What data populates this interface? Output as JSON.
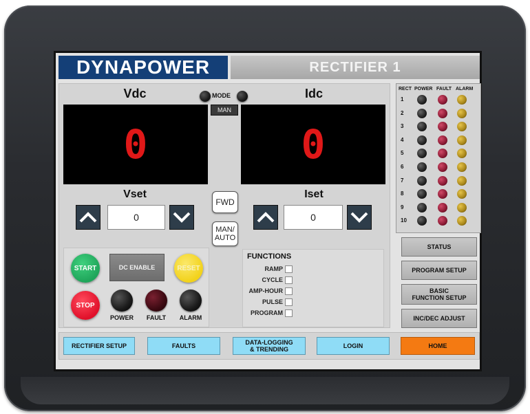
{
  "header": {
    "brand": "DYNAPOWER",
    "title": "RECTIFIER   1"
  },
  "voltage": {
    "label": "Vdc",
    "display_value": "0",
    "set_label": "Vset",
    "set_value": "0"
  },
  "current": {
    "label": "Idc",
    "display_value": "0",
    "set_label": "Iset",
    "set_value": "0"
  },
  "mode": {
    "label": "MODE",
    "value": "MAN"
  },
  "buttons": {
    "fwd": "FWD",
    "man_auto_line1": "MAN/",
    "man_auto_line2": "AUTO",
    "start": "START",
    "dc_enable": "DC ENABLE",
    "reset": "RESET",
    "stop": "STOP"
  },
  "indicators": {
    "power": "POWER",
    "fault": "FAULT",
    "alarm": "ALARM"
  },
  "functions": {
    "title": "FUNCTIONS",
    "items": [
      "RAMP",
      "CYCLE",
      "AMP-HOUR",
      "PULSE",
      "PROGRAM"
    ]
  },
  "status_table": {
    "headers": [
      "RECT",
      "POWER",
      "FAULT",
      "ALARM"
    ],
    "rows": [
      "1",
      "2",
      "3",
      "4",
      "5",
      "6",
      "7",
      "8",
      "9",
      "10"
    ]
  },
  "side_menu": {
    "status": "STATUS",
    "program_setup": "PROGRAM SETUP",
    "basic_line1": "BASIC",
    "basic_line2": "FUNCTION SETUP",
    "inc_dec": "INC/DEC ADJUST"
  },
  "nav": {
    "rectifier_setup": "RECTIFIER SETUP",
    "faults": "FAULTS",
    "data_line1": "DATA-LOGGING",
    "data_line2": "& TRENDING",
    "login": "LOGIN",
    "home": "HOME"
  },
  "colors": {
    "brand_blue": "#143f77",
    "display_red": "#e01818",
    "start_green": "#1fa55a",
    "stop_red": "#e0102a",
    "reset_yellow": "#f2d21a",
    "nav_cyan": "#8fdcf6",
    "home_orange": "#f47a12"
  }
}
